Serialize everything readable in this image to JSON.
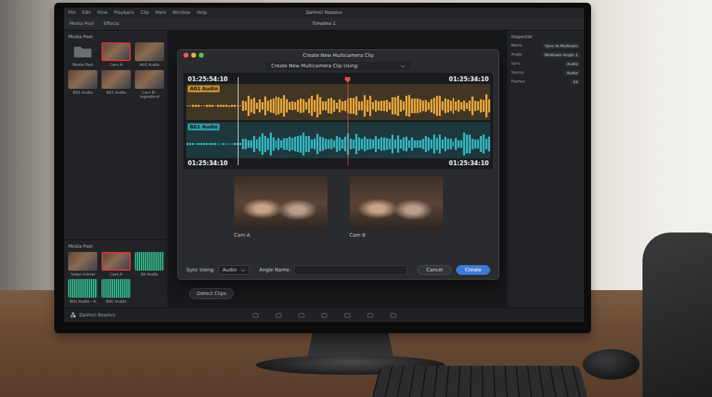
{
  "app": {
    "title": "DaVinci Resolve",
    "timeline": "Timeline 1",
    "menu": [
      "File",
      "Edit",
      "View",
      "Playback",
      "Clip",
      "Mark",
      "Window",
      "Help"
    ],
    "toolbar": [
      "Media Pool",
      "Effects"
    ],
    "logo": "DaVinci Resolve"
  },
  "media_pool": {
    "title": "Media Pool",
    "clips": [
      {
        "label": "Media Pool",
        "kind": "folder",
        "selected": false
      },
      {
        "label": "Cam A",
        "kind": "video",
        "selected": true
      },
      {
        "label": "A01 Audio",
        "kind": "video",
        "selected": false
      },
      {
        "label": "B01 Audio",
        "kind": "video",
        "selected": false
      },
      {
        "label": "B01 Audio",
        "kind": "video",
        "selected": false
      },
      {
        "label": "Cam B - Ingredient",
        "kind": "video",
        "selected": false
      }
    ]
  },
  "media_pool_lower": {
    "title": "Media Pool",
    "clips": [
      {
        "label": "Sister Intrvw",
        "kind": "video",
        "selected": false
      },
      {
        "label": "Cam A",
        "kind": "video",
        "selected": true
      },
      {
        "label": "B0 Audio",
        "kind": "audio",
        "selected": false
      },
      {
        "label": "B01 Audio - A",
        "kind": "audio",
        "selected": false
      },
      {
        "label": "B0C Audio",
        "kind": "audio",
        "selected": false
      }
    ]
  },
  "inspector": {
    "title": "Inspector",
    "fields": [
      {
        "label": "Name",
        "value": "Sync to Multicam"
      },
      {
        "label": "Angle",
        "value": "Multicam Angle 1"
      },
      {
        "label": "Sync",
        "value": "Audio"
      },
      {
        "label": "Source",
        "value": "Audio"
      },
      {
        "label": "Frames",
        "value": "24"
      }
    ]
  },
  "detect_button": "Detect Clips",
  "dialog": {
    "title": "Create New Multicamera Clip",
    "using_label": "Create New Multicamera Clip Using:",
    "timecodes": {
      "top_left": "01:25:54:10",
      "top_right": "01:25:34:10",
      "bottom_left": "01:25:34:10",
      "bottom_right": "01:25:34:10"
    },
    "in_point": 0.17,
    "playhead": 0.53,
    "tracks": [
      {
        "label": "A01 Audio",
        "color": "#e3a33a"
      },
      {
        "label": "B01 Audio",
        "color": "#33b3bd"
      }
    ],
    "angles": [
      {
        "label": "Cam A"
      },
      {
        "label": "Cam B"
      }
    ],
    "sync_label": "Sync Using:",
    "sync_value": "Audio",
    "angle_name_label": "Angle Name:",
    "angle_name_value": "",
    "buttons": [
      {
        "label": "Cancel",
        "primary": false
      },
      {
        "label": "Create",
        "primary": true
      }
    ]
  }
}
